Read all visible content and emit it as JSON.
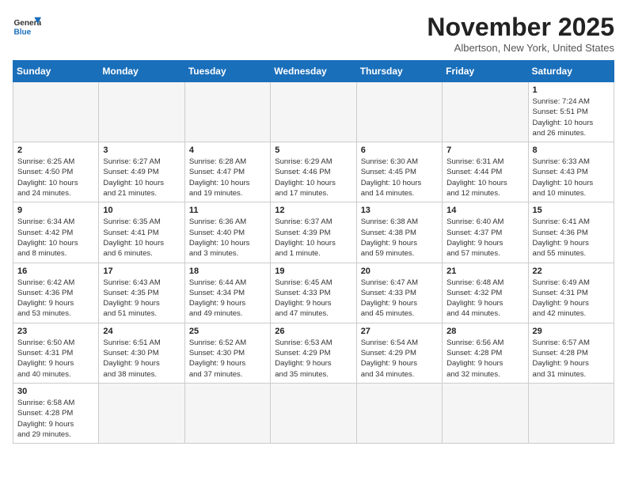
{
  "header": {
    "logo_general": "General",
    "logo_blue": "Blue",
    "month_title": "November 2025",
    "location": "Albertson, New York, United States"
  },
  "days_of_week": [
    "Sunday",
    "Monday",
    "Tuesday",
    "Wednesday",
    "Thursday",
    "Friday",
    "Saturday"
  ],
  "weeks": [
    [
      {
        "day": "",
        "info": ""
      },
      {
        "day": "",
        "info": ""
      },
      {
        "day": "",
        "info": ""
      },
      {
        "day": "",
        "info": ""
      },
      {
        "day": "",
        "info": ""
      },
      {
        "day": "",
        "info": ""
      },
      {
        "day": "1",
        "info": "Sunrise: 7:24 AM\nSunset: 5:51 PM\nDaylight: 10 hours\nand 26 minutes."
      }
    ],
    [
      {
        "day": "2",
        "info": "Sunrise: 6:25 AM\nSunset: 4:50 PM\nDaylight: 10 hours\nand 24 minutes."
      },
      {
        "day": "3",
        "info": "Sunrise: 6:27 AM\nSunset: 4:49 PM\nDaylight: 10 hours\nand 21 minutes."
      },
      {
        "day": "4",
        "info": "Sunrise: 6:28 AM\nSunset: 4:47 PM\nDaylight: 10 hours\nand 19 minutes."
      },
      {
        "day": "5",
        "info": "Sunrise: 6:29 AM\nSunset: 4:46 PM\nDaylight: 10 hours\nand 17 minutes."
      },
      {
        "day": "6",
        "info": "Sunrise: 6:30 AM\nSunset: 4:45 PM\nDaylight: 10 hours\nand 14 minutes."
      },
      {
        "day": "7",
        "info": "Sunrise: 6:31 AM\nSunset: 4:44 PM\nDaylight: 10 hours\nand 12 minutes."
      },
      {
        "day": "8",
        "info": "Sunrise: 6:33 AM\nSunset: 4:43 PM\nDaylight: 10 hours\nand 10 minutes."
      }
    ],
    [
      {
        "day": "9",
        "info": "Sunrise: 6:34 AM\nSunset: 4:42 PM\nDaylight: 10 hours\nand 8 minutes."
      },
      {
        "day": "10",
        "info": "Sunrise: 6:35 AM\nSunset: 4:41 PM\nDaylight: 10 hours\nand 6 minutes."
      },
      {
        "day": "11",
        "info": "Sunrise: 6:36 AM\nSunset: 4:40 PM\nDaylight: 10 hours\nand 3 minutes."
      },
      {
        "day": "12",
        "info": "Sunrise: 6:37 AM\nSunset: 4:39 PM\nDaylight: 10 hours\nand 1 minute."
      },
      {
        "day": "13",
        "info": "Sunrise: 6:38 AM\nSunset: 4:38 PM\nDaylight: 9 hours\nand 59 minutes."
      },
      {
        "day": "14",
        "info": "Sunrise: 6:40 AM\nSunset: 4:37 PM\nDaylight: 9 hours\nand 57 minutes."
      },
      {
        "day": "15",
        "info": "Sunrise: 6:41 AM\nSunset: 4:36 PM\nDaylight: 9 hours\nand 55 minutes."
      }
    ],
    [
      {
        "day": "16",
        "info": "Sunrise: 6:42 AM\nSunset: 4:36 PM\nDaylight: 9 hours\nand 53 minutes."
      },
      {
        "day": "17",
        "info": "Sunrise: 6:43 AM\nSunset: 4:35 PM\nDaylight: 9 hours\nand 51 minutes."
      },
      {
        "day": "18",
        "info": "Sunrise: 6:44 AM\nSunset: 4:34 PM\nDaylight: 9 hours\nand 49 minutes."
      },
      {
        "day": "19",
        "info": "Sunrise: 6:45 AM\nSunset: 4:33 PM\nDaylight: 9 hours\nand 47 minutes."
      },
      {
        "day": "20",
        "info": "Sunrise: 6:47 AM\nSunset: 4:33 PM\nDaylight: 9 hours\nand 45 minutes."
      },
      {
        "day": "21",
        "info": "Sunrise: 6:48 AM\nSunset: 4:32 PM\nDaylight: 9 hours\nand 44 minutes."
      },
      {
        "day": "22",
        "info": "Sunrise: 6:49 AM\nSunset: 4:31 PM\nDaylight: 9 hours\nand 42 minutes."
      }
    ],
    [
      {
        "day": "23",
        "info": "Sunrise: 6:50 AM\nSunset: 4:31 PM\nDaylight: 9 hours\nand 40 minutes."
      },
      {
        "day": "24",
        "info": "Sunrise: 6:51 AM\nSunset: 4:30 PM\nDaylight: 9 hours\nand 38 minutes."
      },
      {
        "day": "25",
        "info": "Sunrise: 6:52 AM\nSunset: 4:30 PM\nDaylight: 9 hours\nand 37 minutes."
      },
      {
        "day": "26",
        "info": "Sunrise: 6:53 AM\nSunset: 4:29 PM\nDaylight: 9 hours\nand 35 minutes."
      },
      {
        "day": "27",
        "info": "Sunrise: 6:54 AM\nSunset: 4:29 PM\nDaylight: 9 hours\nand 34 minutes."
      },
      {
        "day": "28",
        "info": "Sunrise: 6:56 AM\nSunset: 4:28 PM\nDaylight: 9 hours\nand 32 minutes."
      },
      {
        "day": "29",
        "info": "Sunrise: 6:57 AM\nSunset: 4:28 PM\nDaylight: 9 hours\nand 31 minutes."
      }
    ],
    [
      {
        "day": "30",
        "info": "Sunrise: 6:58 AM\nSunset: 4:28 PM\nDaylight: 9 hours\nand 29 minutes."
      },
      {
        "day": "",
        "info": ""
      },
      {
        "day": "",
        "info": ""
      },
      {
        "day": "",
        "info": ""
      },
      {
        "day": "",
        "info": ""
      },
      {
        "day": "",
        "info": ""
      },
      {
        "day": "",
        "info": ""
      }
    ]
  ]
}
